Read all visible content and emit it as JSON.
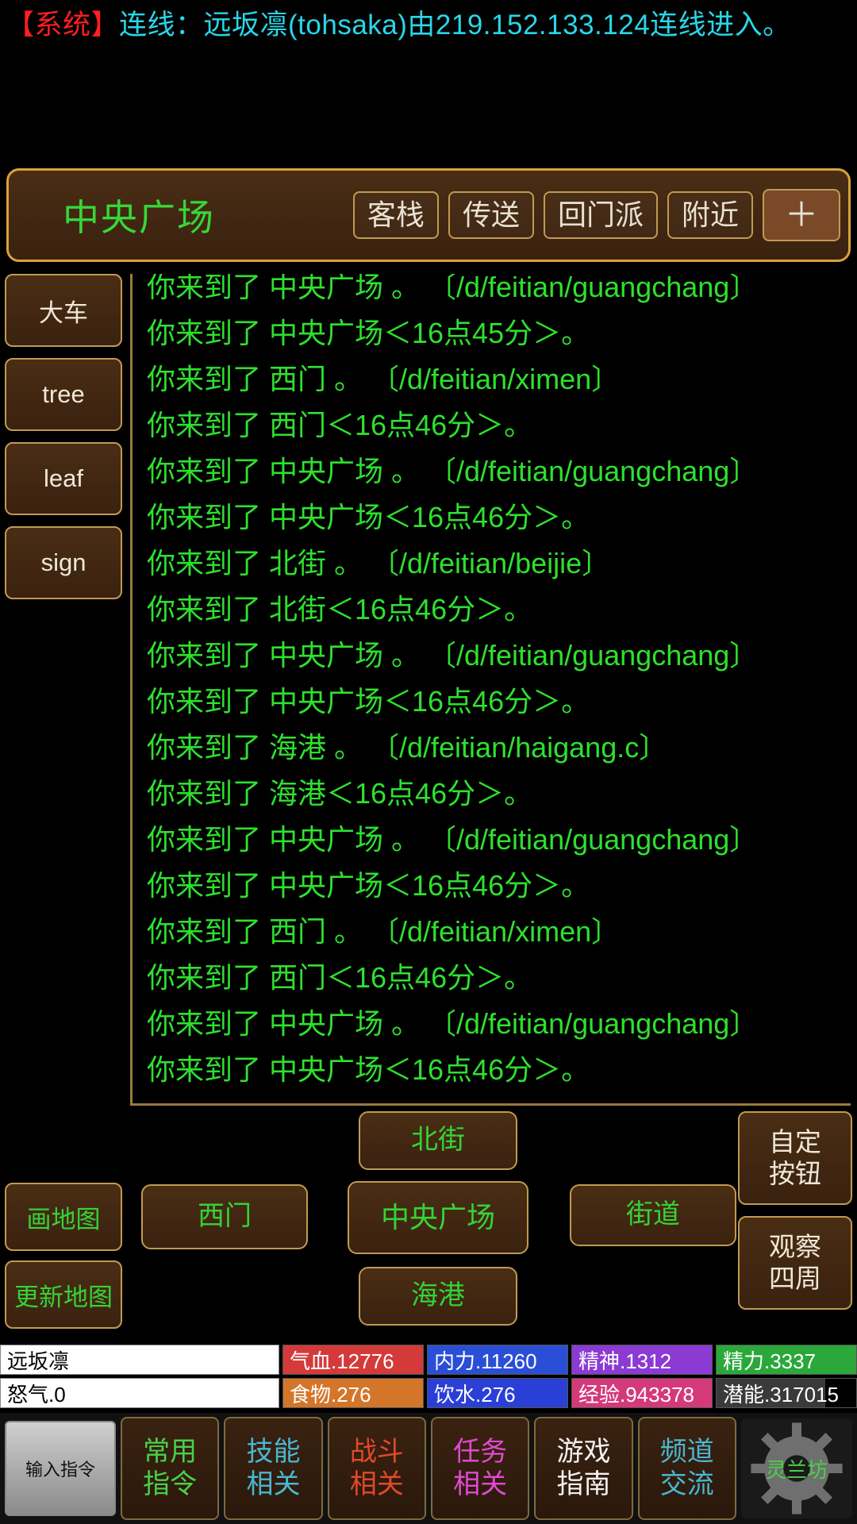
{
  "system_message": {
    "prefix": "【系统】",
    "body": "连线：远坂凛(tohsaka)由219.152.133.124连线进入。"
  },
  "location_bar": {
    "location_name": "中央广场",
    "buttons": [
      {
        "label": "客栈",
        "name": "inn-button"
      },
      {
        "label": "传送",
        "name": "teleport-button"
      },
      {
        "label": "回门派",
        "name": "return-sect-button"
      },
      {
        "label": "附近",
        "name": "nearby-button"
      },
      {
        "label": "＋",
        "name": "add-button"
      }
    ]
  },
  "left_tools": [
    {
      "label": "大车",
      "name": "sidebar-item-cart"
    },
    {
      "label": "tree",
      "name": "sidebar-item-tree"
    },
    {
      "label": "leaf",
      "name": "sidebar-item-leaf"
    },
    {
      "label": "sign",
      "name": "sidebar-item-sign"
    }
  ],
  "log": {
    "lines": [
      "你来到了 中央广场 。 〔/d/feitian/guangchang〕",
      "你来到了 中央广场＜16点45分＞。",
      "你来到了 西门 。 〔/d/feitian/ximen〕",
      "你来到了 西门＜16点46分＞。",
      "你来到了 中央广场 。 〔/d/feitian/guangchang〕",
      "你来到了 中央广场＜16点46分＞。",
      "你来到了 北街 。 〔/d/feitian/beijie〕",
      "你来到了 北街＜16点46分＞。",
      "你来到了 中央广场 。 〔/d/feitian/guangchang〕",
      "你来到了 中央广场＜16点46分＞。",
      "你来到了 海港 。 〔/d/feitian/haigang.c〕",
      "你来到了 海港＜16点46分＞。",
      "你来到了 中央广场 。 〔/d/feitian/guangchang〕",
      "你来到了 中央广场＜16点46分＞。",
      "你来到了 西门 。 〔/d/feitian/ximen〕",
      "你来到了 西门＜16点46分＞。",
      "你来到了 中央广场 。 〔/d/feitian/guangchang〕",
      "你来到了 中央广场＜16点46分＞。"
    ]
  },
  "map": {
    "north": "北街",
    "west": "西门",
    "center": "中央广场",
    "east": "街道",
    "south": "海港",
    "left_buttons": [
      {
        "label": "画地图",
        "name": "draw-map-button"
      },
      {
        "label": "更新地图",
        "name": "update-map-button"
      }
    ],
    "right_buttons": [
      {
        "line1": "自定",
        "line2": "按钮",
        "name": "custom-button"
      },
      {
        "line1": "观察",
        "line2": "四周",
        "name": "look-around-button"
      }
    ]
  },
  "status": {
    "player_name": "远坂凛",
    "anger_label": "怒气.0",
    "row1": [
      {
        "label": "气血.12776",
        "color": "#d43a3a",
        "fill": 100
      },
      {
        "label": "内力.11260",
        "color": "#2a4fd6",
        "fill": 100
      },
      {
        "label": "精神.1312",
        "color": "#8b3ad4",
        "fill": 100
      },
      {
        "label": "精力.3337",
        "color": "#2aa83a",
        "fill": 100
      }
    ],
    "row2": [
      {
        "label": "食物.276",
        "color": "#d4762a",
        "fill": 100
      },
      {
        "label": "饮水.276",
        "color": "#2a3fd6",
        "fill": 100
      },
      {
        "label": "经验.943378",
        "color": "#d43a7a",
        "fill": 100
      },
      {
        "label": "潜能.317015",
        "color": "#3a3a3a",
        "fill": 78
      }
    ]
  },
  "command_bar": {
    "input_label": "输入指令",
    "buttons": [
      {
        "line1": "常用",
        "line2": "指令",
        "color": "#49d149",
        "name": "common-commands-button"
      },
      {
        "line1": "技能",
        "line2": "相关",
        "color": "#49b7d1",
        "name": "skills-button"
      },
      {
        "line1": "战斗",
        "line2": "相关",
        "color": "#e04a2a",
        "name": "combat-button"
      },
      {
        "line1": "任务",
        "line2": "相关",
        "color": "#e04ad1",
        "name": "quests-button"
      },
      {
        "line1": "游戏",
        "line2": "指南",
        "color": "#f2f2f2",
        "name": "game-guide-button"
      },
      {
        "line1": "频道",
        "line2": "交流",
        "color": "#49b7d1",
        "name": "channels-button"
      }
    ],
    "gear_label": "灵兰坊"
  }
}
